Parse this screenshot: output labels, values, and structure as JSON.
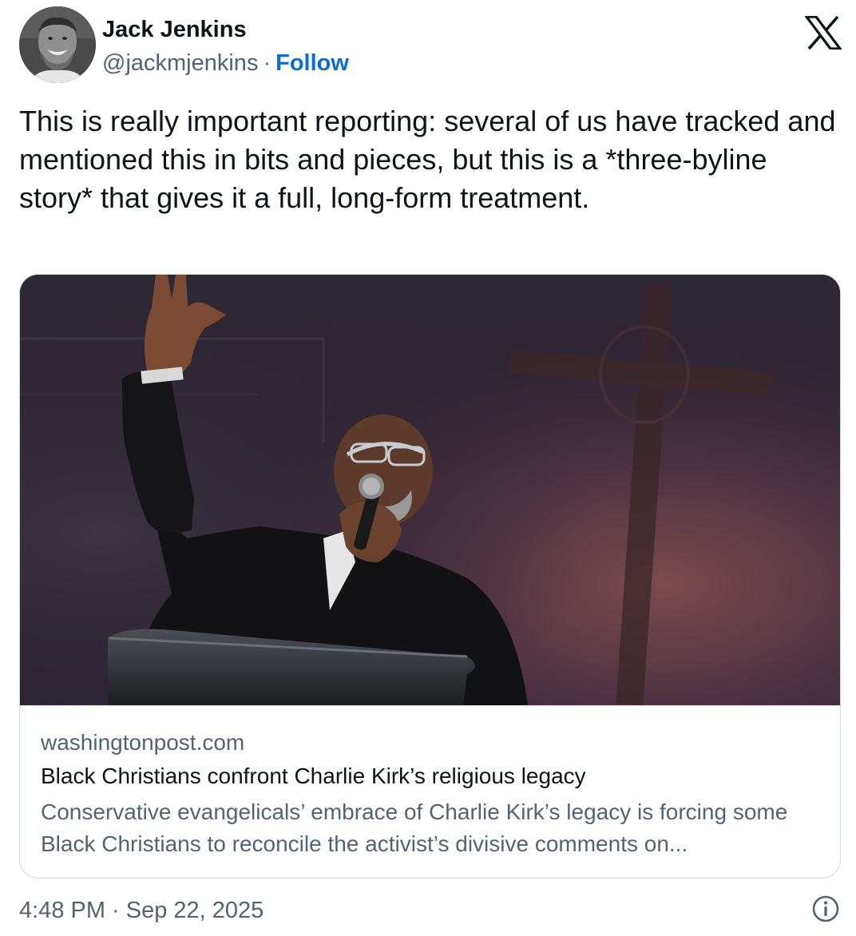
{
  "author": {
    "name": "Jack Jenkins",
    "handle": "@jackmjenkins",
    "separator": "·",
    "follow_label": "Follow"
  },
  "tweet": {
    "text": "This is really important reporting: several of us have tracked and mentioned this in bits and pieces, but this is a *three-byline story* that gives it a full, long-form treatment."
  },
  "card": {
    "image_icon": "photo-preacher-at-pulpit",
    "domain": "washingtonpost.com",
    "title": "Black Christians confront Charlie Kirk’s religious legacy",
    "description": "Conservative evangelicals’ embrace of Charlie Kirk’s legacy is forcing some Black Christians to reconcile the activist’s divisive comments on..."
  },
  "footer": {
    "timestamp": "4:48 PM · Sep 22, 2025",
    "info_icon": "info-icon"
  },
  "icons": {
    "platform_logo": "x-logo-icon"
  },
  "colors": {
    "text": "#0f1419",
    "secondary": "#536471",
    "link": "#0b6fd0",
    "border": "#cfd9de"
  }
}
